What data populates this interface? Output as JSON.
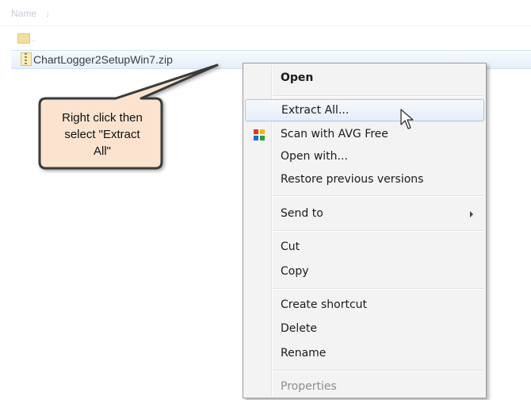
{
  "explorer": {
    "column_header": "Name",
    "sort_glyph": "↓",
    "up_entry": "..",
    "file_name": "ChartLogger2SetupWin7.zip"
  },
  "callout": {
    "line1": "Right click then",
    "line2": "select \"Extract",
    "line3": "All\""
  },
  "context_menu": {
    "items": [
      {
        "label": "Open",
        "bold": true
      },
      {
        "label": "Extract All...",
        "hover": true
      },
      {
        "label": "Scan with AVG Free",
        "icon": "avg-icon"
      },
      {
        "label": "Open with..."
      },
      {
        "label": "Restore previous versions"
      },
      {
        "label": "Send to",
        "submenu": true
      },
      {
        "label": "Cut"
      },
      {
        "label": "Copy"
      },
      {
        "label": "Create shortcut"
      },
      {
        "label": "Delete"
      },
      {
        "label": "Rename"
      },
      {
        "label": "Properties",
        "disabled": true
      }
    ]
  }
}
